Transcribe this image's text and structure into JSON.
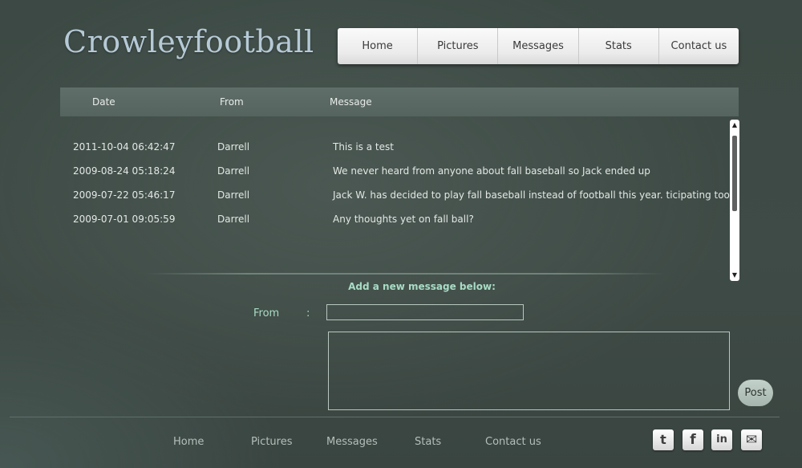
{
  "site": {
    "title": "Crowleyfootball"
  },
  "topnav": {
    "items": [
      "Home",
      "Pictures",
      "Messages",
      "Stats",
      "Contact us"
    ]
  },
  "table": {
    "headers": {
      "date": "Date",
      "from": "From",
      "message": "Message"
    },
    "rows": [
      {
        "date": "2011-10-04 06:42:47",
        "from": "Darrell",
        "message": "This is a test"
      },
      {
        "date": "2009-08-24 05:18:24",
        "from": "Darrell",
        "message": "We never heard from anyone about fall baseball so Jack ended up"
      },
      {
        "date": "2009-07-22 05:46:17",
        "from": "Darrell",
        "message": "Jack W. has decided to play fall baseball instead of football this year. ticipating too!"
      },
      {
        "date": "2009-07-01 09:05:59",
        "from": "Darrell",
        "message": "Any thoughts yet on fall ball?"
      }
    ]
  },
  "form": {
    "title": "Add a new message below:",
    "from_label": "From",
    "colon": ":",
    "from_value": "",
    "message_value": "",
    "post_label": "Post"
  },
  "footer": {
    "items": [
      "Home",
      "Pictures",
      "Messages",
      "Stats",
      "Contact us"
    ]
  },
  "social": [
    {
      "icon": "twitter-icon",
      "glyph": "t"
    },
    {
      "icon": "facebook-icon",
      "glyph": "f"
    },
    {
      "icon": "linkedin-icon",
      "glyph": "in"
    },
    {
      "icon": "email-icon",
      "glyph": "✉"
    }
  ],
  "colors": {
    "background": "#3f4b46",
    "accent": "#a8dcc6",
    "logo": "#b6c9d6"
  }
}
